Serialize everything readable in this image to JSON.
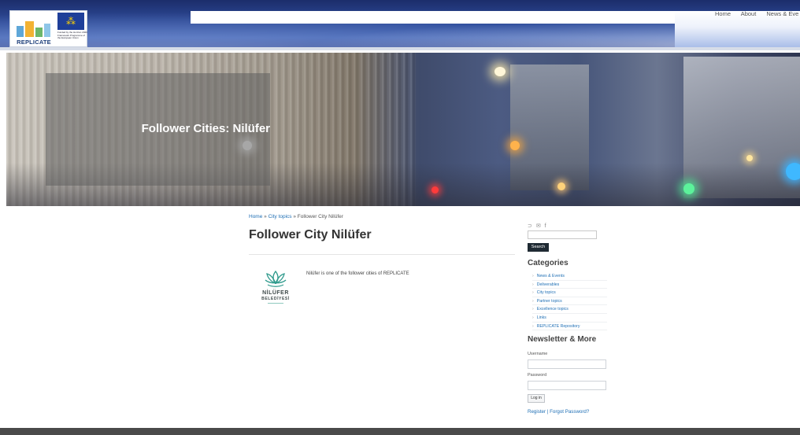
{
  "header": {
    "logo_text": "REPLICATE",
    "eu_funding_text": "Funded by the Horizon 2020 Framework Programme of the European Union",
    "nav": [
      "Home",
      "About",
      "News & Eve"
    ]
  },
  "hero": {
    "title": "Follower Cities: Nilüfer"
  },
  "breadcrumb": {
    "home": "Home",
    "sep1": " » ",
    "section": "City topics",
    "sep2": " » ",
    "current": "Follower City Nilüfer"
  },
  "main": {
    "title": "Follower City Nilüfer",
    "logo_name": "NİLÜFER",
    "logo_sub": "BELEDİYESİ",
    "body": "Nilüfer is one of the follower cities of REPLICATE"
  },
  "sidebar": {
    "social_icons": [
      "rss-icon",
      "email-icon",
      "facebook-icon"
    ],
    "search_button": "Search",
    "categories_heading": "Categories",
    "categories": [
      "News & Events",
      "Deliverables",
      "City topics",
      "Partner topics",
      "Excellence topics",
      "Links",
      "REPLICATE Repository"
    ],
    "newsletter_heading": "Newsletter & More",
    "username_label": "Username",
    "password_label": "Password",
    "login_button": "Log in",
    "register_link": "Register",
    "links_separator": " | ",
    "forgot_link": "Forgot Password?"
  },
  "colors": {
    "link": "#1f6fb5",
    "header_blue": "#2e4c9a",
    "footer": "#4a4a4a"
  }
}
